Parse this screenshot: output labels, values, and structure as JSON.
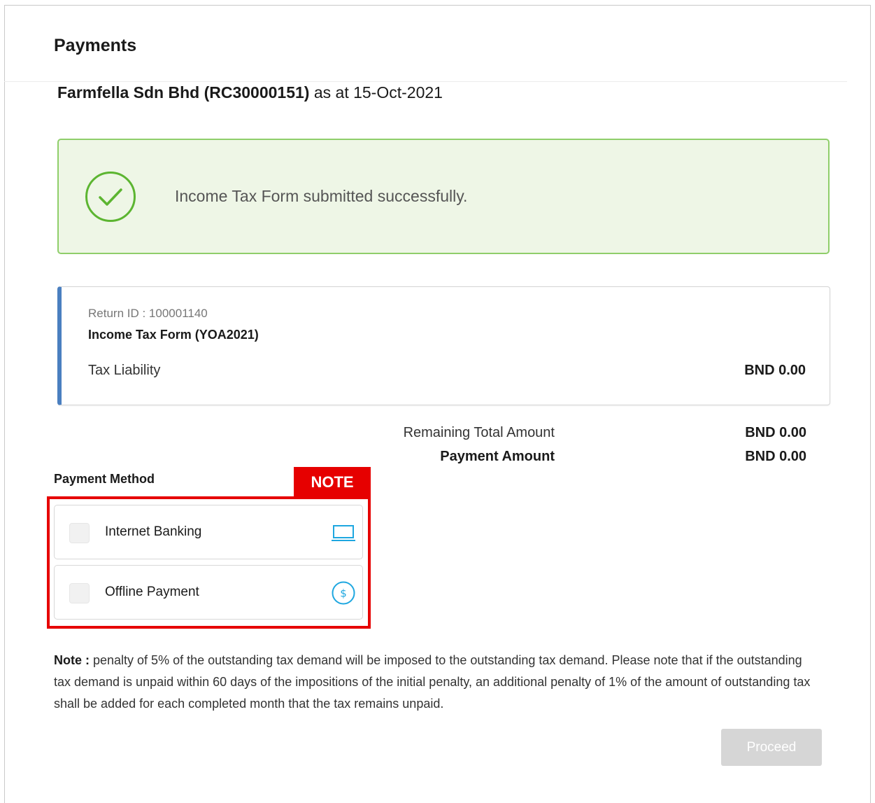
{
  "page": {
    "title": "Payments"
  },
  "entity": {
    "company": "Farmfella Sdn Bhd (RC30000151)",
    "as_at": "as at 15-Oct-2021"
  },
  "alert": {
    "message": "Income Tax Form submitted successfully.",
    "icon": "check-circle-icon",
    "color": "#8fce6a"
  },
  "return_card": {
    "return_id": "Return ID : 100001140",
    "form_name": "Income Tax Form (YOA2021)",
    "tax_liability_label": "Tax Liability",
    "tax_liability_value": "BND 0.00",
    "accent_color": "#4a7fc0"
  },
  "summary": {
    "remaining_label": "Remaining Total Amount",
    "remaining_value": "BND 0.00",
    "payment_label": "Payment Amount",
    "payment_value": "BND 0.00"
  },
  "payment_method": {
    "label": "Payment Method",
    "options": [
      {
        "label": "Internet Banking",
        "icon": "laptop-icon"
      },
      {
        "label": "Offline Payment",
        "icon": "dollar-circle-icon"
      }
    ]
  },
  "annotation": {
    "tag": "NOTE",
    "color": "#e60000"
  },
  "note": {
    "prefix": "Note :",
    "text": " penalty of 5% of the outstanding tax demand will be imposed to the outstanding tax demand. Please note that if the outstanding tax demand is unpaid within 60 days of the impositions of the initial penalty, an additional penalty of 1% of the amount of outstanding tax shall be added for each completed month that the tax remains unpaid."
  },
  "actions": {
    "proceed_label": "Proceed"
  }
}
